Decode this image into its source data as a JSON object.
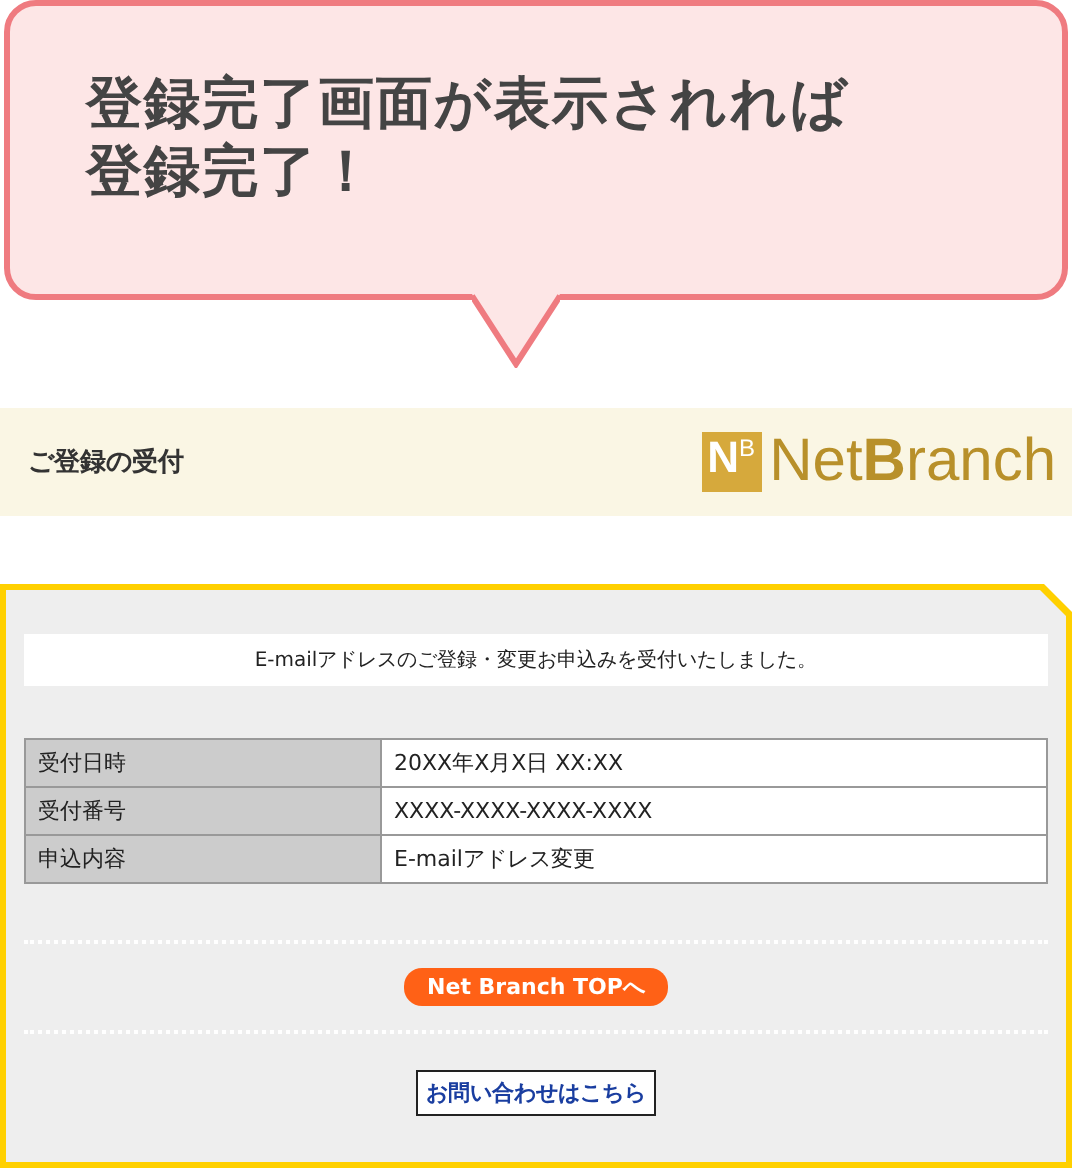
{
  "callout": {
    "lines": [
      "登録完了画面が表示されれば",
      "登録完了！"
    ]
  },
  "header": {
    "title": "ご登録の受付",
    "logo": {
      "mark_main": "N",
      "mark_sub": "B",
      "text_plain": "Net",
      "text_bold": "B",
      "text_rest": "ranch"
    }
  },
  "notice": "E-mailアドレスのご登録・変更お申込みを受付いたしました。",
  "table": {
    "rows": [
      {
        "label": "受付日時",
        "value": "20XX年X月X日 XX:XX"
      },
      {
        "label": "受付番号",
        "value": "XXXX-XXXX-XXXX-XXXX"
      },
      {
        "label": "申込内容",
        "value": "E-mailアドレス変更"
      }
    ]
  },
  "buttons": [
    {
      "kind": "pill",
      "label": "Net Branch TOPへ"
    },
    {
      "kind": "boxed",
      "label": "お問い合わせはこちら"
    }
  ]
}
